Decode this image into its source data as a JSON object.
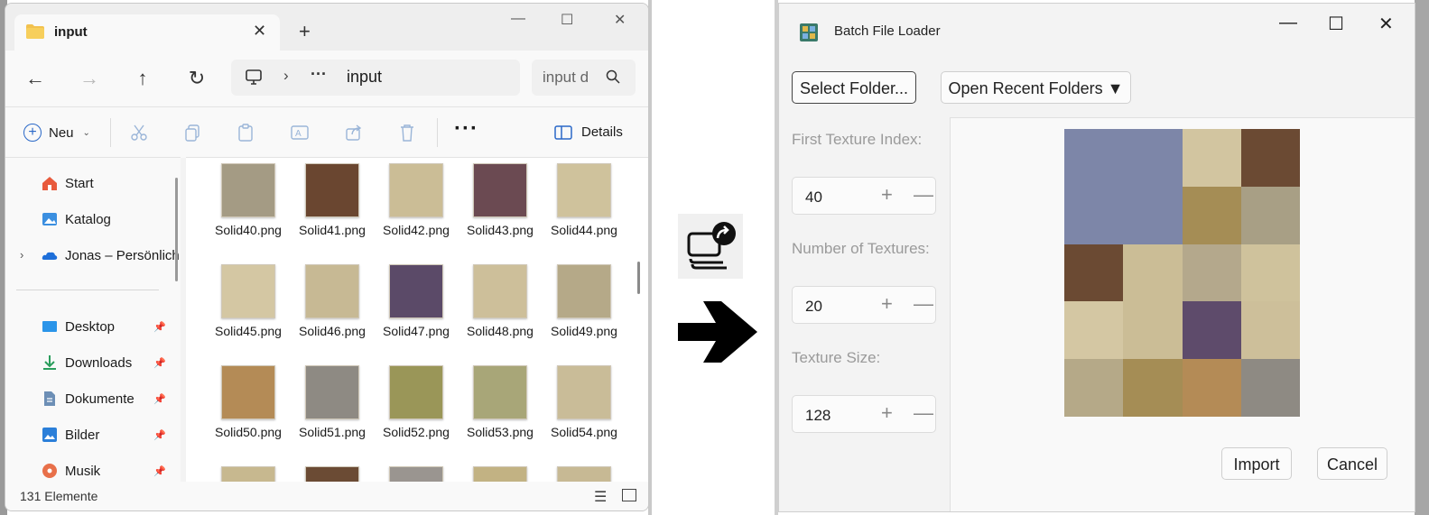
{
  "explorer": {
    "tab_title": "input",
    "tab_close_glyph": "✕",
    "new_tab_glyph": "+",
    "window_controls": {
      "minimize": "—",
      "maximize": "☐",
      "close": "✕"
    },
    "nav": {
      "back": "←",
      "forward": "→",
      "up": "↑",
      "refresh": "↻"
    },
    "address": {
      "separator": "›",
      "ellipsis": "···",
      "crumb": "input"
    },
    "search": {
      "placeholder": "input d"
    },
    "toolbar": {
      "new_label": "Neu",
      "more_label": "···",
      "details_label": "Details",
      "icons": [
        "cut-icon",
        "copy-icon",
        "paste-icon",
        "rename-icon",
        "share-icon",
        "delete-icon"
      ]
    },
    "sidebar": {
      "items": [
        {
          "label": "Start",
          "icon": "home-icon"
        },
        {
          "label": "Katalog",
          "icon": "gallery-icon"
        },
        {
          "label": "Jonas – Persönlich",
          "icon": "onedrive-icon"
        },
        {
          "label": "Desktop",
          "icon": "desktop-icon"
        },
        {
          "label": "Downloads",
          "icon": "downloads-icon"
        },
        {
          "label": "Dokumente",
          "icon": "documents-icon"
        },
        {
          "label": "Bilder",
          "icon": "pictures-icon"
        },
        {
          "label": "Musik",
          "icon": "music-icon"
        }
      ],
      "expand_glyph": "›",
      "pin_glyph": "📌"
    },
    "files": [
      {
        "name": "Solid40.png",
        "color": "#a49b84"
      },
      {
        "name": "Solid41.png",
        "color": "#6a4630"
      },
      {
        "name": "Solid42.png",
        "color": "#cbbd96"
      },
      {
        "name": "Solid43.png",
        "color": "#6b4a52"
      },
      {
        "name": "Solid44.png",
        "color": "#cfc29c"
      },
      {
        "name": "Solid45.png",
        "color": "#d4c7a3"
      },
      {
        "name": "Solid46.png",
        "color": "#c7b994"
      },
      {
        "name": "Solid47.png",
        "color": "#5b4a68"
      },
      {
        "name": "Solid48.png",
        "color": "#cdbf9a"
      },
      {
        "name": "Solid49.png",
        "color": "#b5a988"
      },
      {
        "name": "Solid50.png",
        "color": "#b48b56"
      },
      {
        "name": "Solid51.png",
        "color": "#8e8a83"
      },
      {
        "name": "Solid52.png",
        "color": "#9a9658"
      },
      {
        "name": "Solid53.png",
        "color": "#a8a678"
      },
      {
        "name": "Solid54.png",
        "color": "#c9bc98"
      },
      {
        "name": "",
        "color": "#c7b88f"
      },
      {
        "name": "",
        "color": "#6b4b34"
      },
      {
        "name": "",
        "color": "#9a9590"
      },
      {
        "name": "",
        "color": "#c2b283"
      },
      {
        "name": "",
        "color": "#c7b994"
      }
    ],
    "status": {
      "count": "131 Elemente"
    }
  },
  "loader": {
    "title": "Batch File Loader",
    "window_controls": {
      "minimize": "—",
      "maximize": "☐",
      "close": "✕"
    },
    "select_folder_label": "Select Folder...",
    "recent_folders_label": "Open Recent Folders ▼",
    "first_index": {
      "label": "First Texture Index:",
      "value": "40"
    },
    "num_textures": {
      "label": "Number of Textures:",
      "value": "20"
    },
    "texture_size": {
      "label": "Texture Size:",
      "value": "128"
    },
    "stepper_plus": "+",
    "stepper_minus": "—",
    "import_label": "Import",
    "cancel_label": "Cancel",
    "atlas_tiles": [
      {
        "color": "#7d86a8"
      },
      {
        "color": "#7d86a8"
      },
      {
        "color": "#d2c5a0"
      },
      {
        "color": "#6b4a33"
      },
      {
        "color": "#7d86a8"
      },
      {
        "color": "#7d86a8"
      },
      {
        "color": "#a58d55"
      },
      {
        "color": "#a89f85"
      },
      {
        "color": "#6b4a33"
      },
      {
        "color": "#cbbd96"
      },
      {
        "color": "#b4a88c"
      },
      {
        "color": "#cfc29c"
      },
      {
        "color": "#d4c7a3"
      },
      {
        "color": "#cbbd96"
      },
      {
        "color": "#5e4b6b"
      },
      {
        "color": "#cdbf9a"
      },
      {
        "color": "#b5a988"
      },
      {
        "color": "#a58d55"
      },
      {
        "color": "#b48b56"
      },
      {
        "color": "#8e8a83"
      }
    ]
  }
}
